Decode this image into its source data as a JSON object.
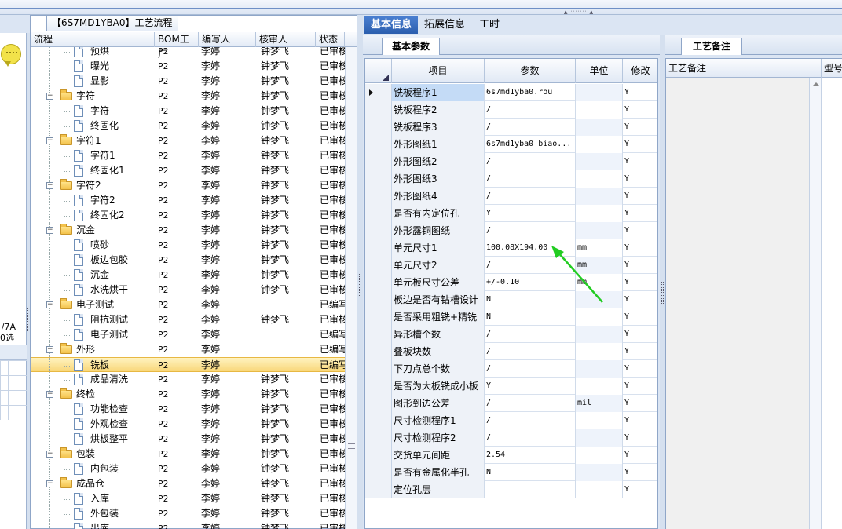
{
  "tree_panel": {
    "title": "【6S7MD1YBA0】工艺流程",
    "columns": [
      "流程",
      "BOM工厂",
      "编写人",
      "核审人",
      "状态"
    ],
    "rows": [
      {
        "level": 2,
        "kind": "doc",
        "name": "预烘",
        "bom": "P2",
        "author": "李婷",
        "reviewer": "钟梦飞",
        "status": "已审核"
      },
      {
        "level": 2,
        "kind": "doc",
        "name": "曝光",
        "bom": "P2",
        "author": "李婷",
        "reviewer": "钟梦飞",
        "status": "已审核"
      },
      {
        "level": 2,
        "kind": "doc",
        "name": "显影",
        "bom": "P2",
        "author": "李婷",
        "reviewer": "钟梦飞",
        "status": "已审核"
      },
      {
        "level": 1,
        "kind": "folder",
        "name": "字符",
        "bom": "P2",
        "author": "李婷",
        "reviewer": "钟梦飞",
        "status": "已审核"
      },
      {
        "level": 2,
        "kind": "doc",
        "name": "字符",
        "bom": "P2",
        "author": "李婷",
        "reviewer": "钟梦飞",
        "status": "已审核"
      },
      {
        "level": 2,
        "kind": "doc",
        "name": "终固化",
        "bom": "P2",
        "author": "李婷",
        "reviewer": "钟梦飞",
        "status": "已审核"
      },
      {
        "level": 1,
        "kind": "folder",
        "name": "字符1",
        "bom": "P2",
        "author": "李婷",
        "reviewer": "钟梦飞",
        "status": "已审核"
      },
      {
        "level": 2,
        "kind": "doc",
        "name": "字符1",
        "bom": "P2",
        "author": "李婷",
        "reviewer": "钟梦飞",
        "status": "已审核"
      },
      {
        "level": 2,
        "kind": "doc",
        "name": "终固化1",
        "bom": "P2",
        "author": "李婷",
        "reviewer": "钟梦飞",
        "status": "已审核"
      },
      {
        "level": 1,
        "kind": "folder",
        "name": "字符2",
        "bom": "P2",
        "author": "李婷",
        "reviewer": "钟梦飞",
        "status": "已审核"
      },
      {
        "level": 2,
        "kind": "doc",
        "name": "字符2",
        "bom": "P2",
        "author": "李婷",
        "reviewer": "钟梦飞",
        "status": "已审核"
      },
      {
        "level": 2,
        "kind": "doc",
        "name": "终固化2",
        "bom": "P2",
        "author": "李婷",
        "reviewer": "钟梦飞",
        "status": "已审核"
      },
      {
        "level": 1,
        "kind": "folder",
        "name": "沉金",
        "bom": "P2",
        "author": "李婷",
        "reviewer": "钟梦飞",
        "status": "已审核"
      },
      {
        "level": 2,
        "kind": "doc",
        "name": "喷砂",
        "bom": "P2",
        "author": "李婷",
        "reviewer": "钟梦飞",
        "status": "已审核"
      },
      {
        "level": 2,
        "kind": "doc",
        "name": "板边包胶",
        "bom": "P2",
        "author": "李婷",
        "reviewer": "钟梦飞",
        "status": "已审核"
      },
      {
        "level": 2,
        "kind": "doc",
        "name": "沉金",
        "bom": "P2",
        "author": "李婷",
        "reviewer": "钟梦飞",
        "status": "已审核"
      },
      {
        "level": 2,
        "kind": "doc",
        "name": "水洗烘干",
        "bom": "P2",
        "author": "李婷",
        "reviewer": "钟梦飞",
        "status": "已审核"
      },
      {
        "level": 1,
        "kind": "folder",
        "name": "电子测试",
        "bom": "P2",
        "author": "李婷",
        "reviewer": "",
        "status": "已编写"
      },
      {
        "level": 2,
        "kind": "doc",
        "name": "阻抗测试",
        "bom": "P2",
        "author": "李婷",
        "reviewer": "钟梦飞",
        "status": "已审核"
      },
      {
        "level": 2,
        "kind": "doc",
        "name": "电子测试",
        "bom": "P2",
        "author": "李婷",
        "reviewer": "",
        "status": "已编写"
      },
      {
        "level": 1,
        "kind": "folder",
        "name": "外形",
        "bom": "P2",
        "author": "李婷",
        "reviewer": "",
        "status": "已编写"
      },
      {
        "level": 2,
        "kind": "doc",
        "name": "铣板",
        "bom": "P2",
        "author": "李婷",
        "reviewer": "",
        "status": "已编写",
        "selected": true
      },
      {
        "level": 2,
        "kind": "doc",
        "name": "成品清洗",
        "bom": "P2",
        "author": "李婷",
        "reviewer": "钟梦飞",
        "status": "已审核"
      },
      {
        "level": 1,
        "kind": "folder",
        "name": "终检",
        "bom": "P2",
        "author": "李婷",
        "reviewer": "钟梦飞",
        "status": "已审核"
      },
      {
        "level": 2,
        "kind": "doc",
        "name": "功能检查",
        "bom": "P2",
        "author": "李婷",
        "reviewer": "钟梦飞",
        "status": "已审核"
      },
      {
        "level": 2,
        "kind": "doc",
        "name": "外观检查",
        "bom": "P2",
        "author": "李婷",
        "reviewer": "钟梦飞",
        "status": "已审核"
      },
      {
        "level": 2,
        "kind": "doc",
        "name": "烘板整平",
        "bom": "P2",
        "author": "李婷",
        "reviewer": "钟梦飞",
        "status": "已审核"
      },
      {
        "level": 1,
        "kind": "folder",
        "name": "包装",
        "bom": "P2",
        "author": "李婷",
        "reviewer": "钟梦飞",
        "status": "已审核"
      },
      {
        "level": 2,
        "kind": "doc",
        "name": "内包装",
        "bom": "P2",
        "author": "李婷",
        "reviewer": "钟梦飞",
        "status": "已审核"
      },
      {
        "level": 1,
        "kind": "folder",
        "name": "成品仓",
        "bom": "P2",
        "author": "李婷",
        "reviewer": "钟梦飞",
        "status": "已审核"
      },
      {
        "level": 2,
        "kind": "doc",
        "name": "入库",
        "bom": "P2",
        "author": "李婷",
        "reviewer": "钟梦飞",
        "status": "已审核"
      },
      {
        "level": 2,
        "kind": "doc",
        "name": "外包装",
        "bom": "P2",
        "author": "李婷",
        "reviewer": "钟梦飞",
        "status": "已审核"
      },
      {
        "level": 2,
        "kind": "doc",
        "name": "出库",
        "bom": "P2",
        "author": "李婷",
        "reviewer": "钟梦飞",
        "status": "已审核"
      }
    ]
  },
  "left_strip": {
    "text1": "/7A",
    "text2": "0选"
  },
  "main_tabs": [
    "基本信息",
    "拓展信息",
    "工时"
  ],
  "params_panel": {
    "subtab": "基本参数",
    "columns": [
      "项目",
      "参数",
      "单位",
      "修改"
    ],
    "rows": [
      {
        "item": "铣板程序1",
        "param": "6s7md1yba0.rou",
        "unit": "",
        "mod": "Y"
      },
      {
        "item": "铣板程序2",
        "param": "/",
        "unit": "",
        "mod": "Y"
      },
      {
        "item": "铣板程序3",
        "param": "/",
        "unit": "",
        "mod": "Y"
      },
      {
        "item": "外形图纸1",
        "param": "6s7md1yba0_biao...",
        "unit": "",
        "mod": "Y"
      },
      {
        "item": "外形图纸2",
        "param": "/",
        "unit": "",
        "mod": "Y"
      },
      {
        "item": "外形图纸3",
        "param": "/",
        "unit": "",
        "mod": "Y"
      },
      {
        "item": "外形图纸4",
        "param": "/",
        "unit": "",
        "mod": "Y"
      },
      {
        "item": "是否有内定位孔",
        "param": "Y",
        "unit": "",
        "mod": "Y"
      },
      {
        "item": "外形露铜图纸",
        "param": "/",
        "unit": "",
        "mod": "Y"
      },
      {
        "item": "单元尺寸1",
        "param": "100.08X194.00",
        "unit": "mm",
        "mod": "Y"
      },
      {
        "item": "单元尺寸2",
        "param": "/",
        "unit": "mm",
        "mod": "Y"
      },
      {
        "item": "单元板尺寸公差",
        "param": "+/-0.10",
        "unit": "mm",
        "mod": "Y"
      },
      {
        "item": "板边是否有钻槽设计",
        "param": "N",
        "unit": "",
        "mod": "Y"
      },
      {
        "item": "是否采用粗铣+精铣",
        "param": "N",
        "unit": "",
        "mod": "Y"
      },
      {
        "item": "异形槽个数",
        "param": "/",
        "unit": "",
        "mod": "Y"
      },
      {
        "item": "叠板块数",
        "param": "/",
        "unit": "",
        "mod": "Y"
      },
      {
        "item": "下刀点总个数",
        "param": "/",
        "unit": "",
        "mod": "Y"
      },
      {
        "item": "是否为大板铣成小板",
        "param": "Y",
        "unit": "",
        "mod": "Y"
      },
      {
        "item": "图形到边公差",
        "param": "/",
        "unit": "mil",
        "mod": "Y"
      },
      {
        "item": "尺寸检测程序1",
        "param": "/",
        "unit": "",
        "mod": "Y"
      },
      {
        "item": "尺寸检测程序2",
        "param": "/",
        "unit": "",
        "mod": "Y"
      },
      {
        "item": "交货单元间距",
        "param": "2.54",
        "unit": "",
        "mod": "Y"
      },
      {
        "item": "是否有金属化半孔",
        "param": "N",
        "unit": "",
        "mod": "Y"
      },
      {
        "item": "定位孔层",
        "param": "",
        "unit": "",
        "mod": "Y"
      }
    ]
  },
  "remarks_panel": {
    "tab": "工艺备注",
    "columns": [
      "工艺备注",
      "型号"
    ]
  },
  "colors": {
    "accent_tab": "#2b5eae",
    "selection": "#f9d77a",
    "annotation_arrow": "#22cc22"
  }
}
